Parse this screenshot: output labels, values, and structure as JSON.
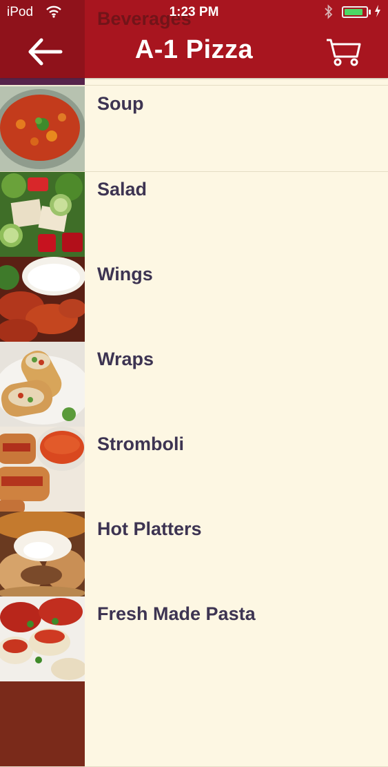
{
  "status_bar": {
    "carrier": "iPod",
    "time": "1:23 PM",
    "battery_level": 0.85
  },
  "nav": {
    "title": "A-1 Pizza",
    "back_icon": "arrow-left-icon",
    "cart_icon": "cart-icon"
  },
  "menu": {
    "items": [
      {
        "label": "Beverages"
      },
      {
        "label": "Soup"
      },
      {
        "label": "Salad"
      },
      {
        "label": "Wings"
      },
      {
        "label": "Wraps"
      },
      {
        "label": "Stromboli"
      },
      {
        "label": "Hot Platters"
      },
      {
        "label": "Fresh Made Pasta"
      }
    ]
  },
  "colors": {
    "header": "#a8151f",
    "background": "#fdf7e3",
    "label": "#3d3452"
  }
}
